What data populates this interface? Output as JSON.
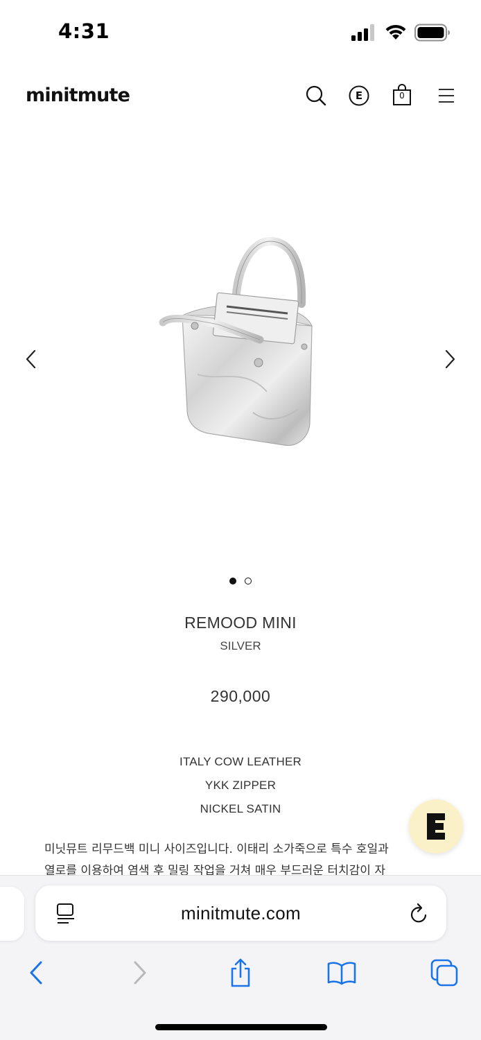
{
  "status_bar": {
    "time": "4:31",
    "signal_icon": "cellular-signal-icon",
    "wifi_icon": "wifi-icon",
    "battery_icon": "battery-icon"
  },
  "header": {
    "logo": "minitmute",
    "icons": [
      "search-icon",
      "e-circle-icon",
      "shopping-bag-icon",
      "hamburger-menu-icon"
    ],
    "e_label": "E",
    "cart_count": "0"
  },
  "gallery": {
    "image": "silver-tote-bag-image",
    "prev_icon": "chevron-left-icon",
    "next_icon": "chevron-right-icon",
    "slide_count": 2,
    "active_slide": 1
  },
  "product": {
    "name": "REMOOD MINI",
    "color": "SILVER",
    "price": "290,000",
    "specs": [
      "ITALY COW LEATHER",
      "YKK ZIPPER",
      "NICKEL SATIN"
    ],
    "description_line1": "미닛뮤트 리무드백 미니 사이즈입니다. 이태리 소가죽으로 특수 호일과",
    "description_line2": "열로를 이용하여 염색 후 밀링 작업을 거쳐 매우 부드러운 터치감이 자"
  },
  "floating_button": {
    "icon": "e-logo-icon"
  },
  "browser": {
    "url": "minitmute.com",
    "icons": [
      "reader-mode-icon",
      "reload-icon",
      "back-arrow-icon",
      "forward-arrow-icon",
      "share-icon",
      "bookmarks-icon",
      "tabs-icon"
    ]
  },
  "colors": {
    "accent_blue": "#1a73e8",
    "text_dark": "#222222",
    "floating_bg": "#fbf1c8"
  }
}
